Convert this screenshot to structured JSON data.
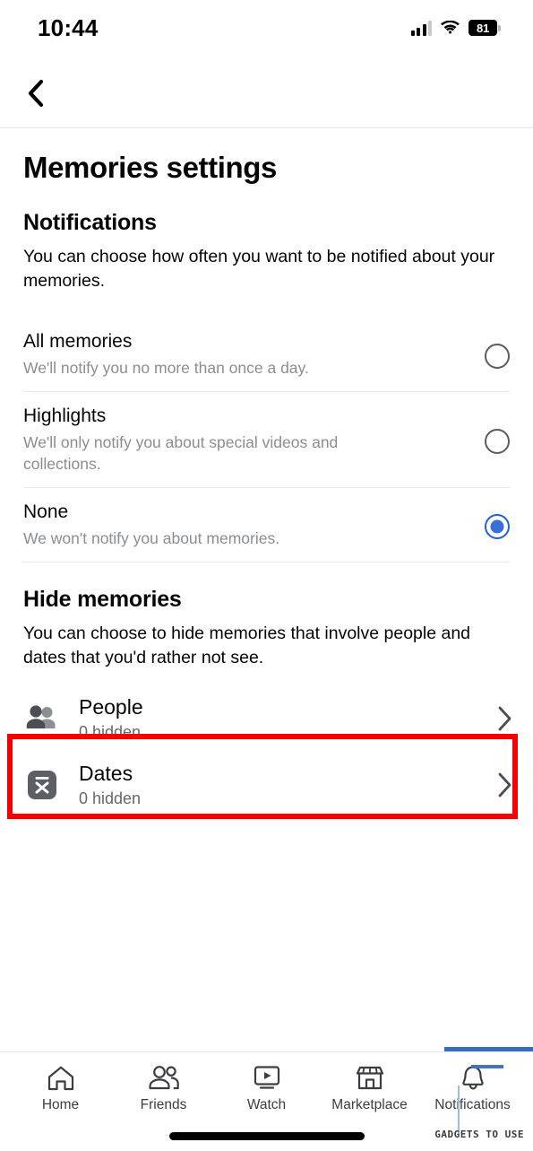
{
  "status_bar": {
    "time": "10:44",
    "battery_percent": "81",
    "signal_icon": "cellular-signal-icon",
    "wifi_icon": "wifi-icon",
    "battery_icon": "battery-icon"
  },
  "nav": {
    "back_icon": "chevron-left-icon"
  },
  "page": {
    "title": "Memories settings"
  },
  "notifications": {
    "heading": "Notifications",
    "description": "You can choose how often you want to be notified about your memories.",
    "options": [
      {
        "label": "All memories",
        "sublabel": "We'll notify you no more than once a day.",
        "selected": false
      },
      {
        "label": "Highlights",
        "sublabel": "We'll only notify you about special videos and collections.",
        "selected": false
      },
      {
        "label": "None",
        "sublabel": "We won't notify you about memories.",
        "selected": true
      }
    ]
  },
  "hide_memories": {
    "heading": "Hide memories",
    "description": "You can choose to hide memories that involve people and dates that you'd rather not see.",
    "rows": [
      {
        "label": "People",
        "sublabel": "0 hidden",
        "icon": "people-icon",
        "chevron": "chevron-right-icon",
        "highlighted": false
      },
      {
        "label": "Dates",
        "sublabel": "0 hidden",
        "icon": "calendar-x-icon",
        "chevron": "chevron-right-icon",
        "highlighted": true
      }
    ]
  },
  "tabbar": {
    "items": [
      {
        "label": "Home",
        "icon": "home-icon"
      },
      {
        "label": "Friends",
        "icon": "friends-icon"
      },
      {
        "label": "Watch",
        "icon": "watch-video-icon"
      },
      {
        "label": "Marketplace",
        "icon": "marketplace-store-icon"
      },
      {
        "label": "Notifications",
        "icon": "bell-icon"
      }
    ]
  },
  "watermark": {
    "text": "GADGETS TO USE"
  },
  "colors": {
    "accent_blue": "#3a6fd8",
    "highlight_red": "#f60000",
    "primary_text": "#050505",
    "secondary_text": "#8a8d91",
    "divider": "#e8eaed"
  }
}
